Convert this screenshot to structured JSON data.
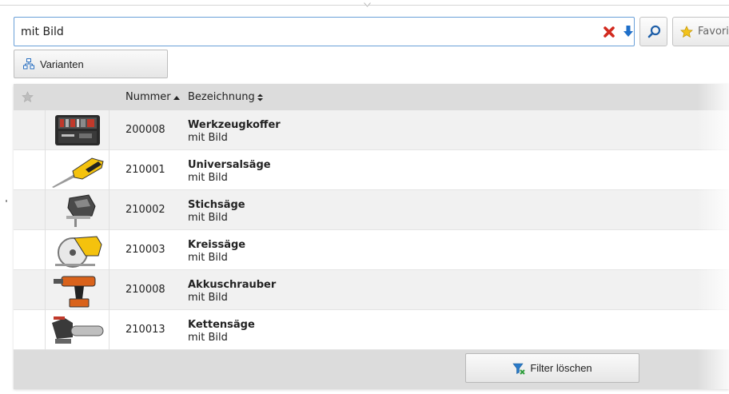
{
  "search": {
    "value": "mit Bild",
    "clear_icon": "clear-x-icon",
    "expand_icon": "arrow-down-icon"
  },
  "toolbar": {
    "search_icon": "magnifier-icon",
    "favorites_label": "Favori",
    "favorites_icon": "star-icon"
  },
  "variants": {
    "label": "Varianten",
    "icon": "variants-tree-icon"
  },
  "grid": {
    "columns": {
      "favorite_icon": "star-icon",
      "nummer": "Nummer",
      "bezeichnung": "Bezeichnung"
    },
    "sort": {
      "nummer": "ascending",
      "bezeichnung": "unsorted"
    },
    "rows": [
      {
        "nummer": "200008",
        "title": "Werkzeugkoffer",
        "subtitle": "mit Bild",
        "image_icon": "toolbox-icon"
      },
      {
        "nummer": "210001",
        "title": "Universalsäge",
        "subtitle": "mit Bild",
        "image_icon": "reciprocating-saw-icon"
      },
      {
        "nummer": "210002",
        "title": "Stichsäge",
        "subtitle": "mit Bild",
        "image_icon": "jigsaw-icon"
      },
      {
        "nummer": "210003",
        "title": "Kreissäge",
        "subtitle": "mit Bild",
        "image_icon": "circular-saw-icon"
      },
      {
        "nummer": "210008",
        "title": "Akkuschrauber",
        "subtitle": "mit Bild",
        "image_icon": "cordless-drill-icon"
      },
      {
        "nummer": "210013",
        "title": "Kettensäge",
        "subtitle": "mit Bild",
        "image_icon": "chainsaw-icon"
      }
    ]
  },
  "footer": {
    "filter_clear_label": "Filter löschen",
    "filter_icon": "filter-clear-icon"
  },
  "colors": {
    "search_border": "#6aa0d8",
    "clear_red": "#d22a1f",
    "arrow_blue": "#1f6fc9",
    "header_bg": "#dcdcdc",
    "row_alt": "#f1f1f1",
    "star_yellow": "#f2c21b"
  }
}
